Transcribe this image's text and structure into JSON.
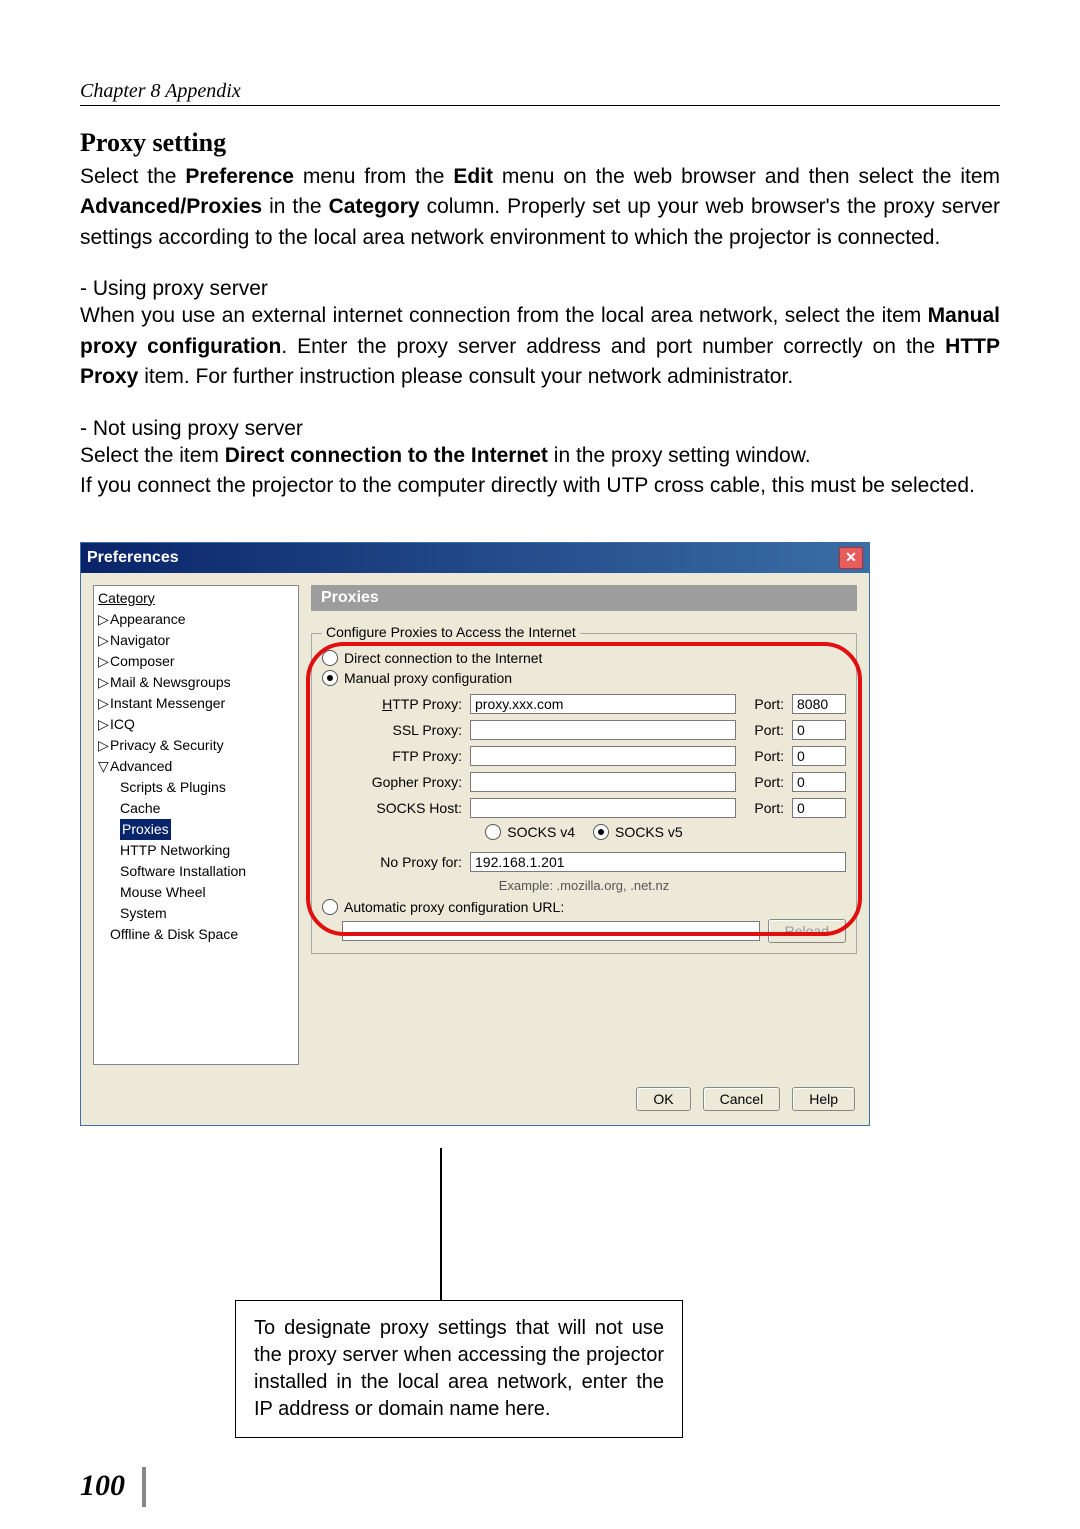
{
  "chapter_header": "Chapter 8 Appendix",
  "section_heading": "Proxy setting",
  "intro_prefix": "Select the ",
  "intro_bold1": "Preference",
  "intro_mid1": " menu from the ",
  "intro_bold2": "Edit",
  "intro_mid2": " menu on the web browser and then select the item ",
  "intro_bold3": "Advanced/Proxies",
  "intro_mid3": " in the ",
  "intro_bold4": "Category",
  "intro_mid4": " column. Properly set up your web browser's the proxy server settings according to the local area network environment to which the projector is connected.",
  "sub1_heading": "- Using proxy server",
  "sub1_prefix": "When you use an external internet connection from the local area network, select the item ",
  "sub1_bold": "Manual proxy configuration",
  "sub1_mid": ". Enter the proxy server address and port number correctly on the ",
  "sub1_bold2": "HTTP Proxy",
  "sub1_suffix": " item. For further instruction please consult your network administrator.",
  "sub2_heading": "- Not using proxy server",
  "sub2_prefix": "Select the item ",
  "sub2_bold": "Direct connection to the Internet",
  "sub2_suffix": " in the proxy setting window.",
  "sub2_line2": "If you connect the projector to the computer directly with UTP cross cable, this must be selected.",
  "dialog": {
    "title": "Preferences",
    "tree_header": "Category",
    "tree": [
      "Appearance",
      "Navigator",
      "Composer",
      "Mail & Newsgroups",
      "Instant Messenger",
      "ICQ",
      "Privacy & Security"
    ],
    "tree_advanced": "Advanced",
    "tree_sub": [
      "Scripts & Plugins",
      "Cache",
      "Proxies",
      "HTTP Networking",
      "Software Installation",
      "Mouse Wheel",
      "System"
    ],
    "tree_last": "Offline & Disk Space",
    "panel_title": "Proxies",
    "legend": "Configure Proxies to Access the Internet",
    "radio1": "Direct connection to the Internet",
    "radio2": "Manual proxy configuration",
    "radio3": "Automatic proxy configuration URL:",
    "rows": {
      "http": {
        "label": "HTTP Proxy:",
        "value": "proxy.xxx.com",
        "port_label": "Port:",
        "port": "8080"
      },
      "ssl": {
        "label": "SSL Proxy:",
        "value": "",
        "port_label": "Port:",
        "port": "0"
      },
      "ftp": {
        "label": "FTP Proxy:",
        "value": "",
        "port_label": "Port:",
        "port": "0"
      },
      "gopher": {
        "label": "Gopher Proxy:",
        "value": "",
        "port_label": "Port:",
        "port": "0"
      },
      "socks": {
        "label": "SOCKS Host:",
        "value": "",
        "port_label": "Port:",
        "port": "0"
      }
    },
    "socksv4": "SOCKS v4",
    "socksv5": "SOCKS v5",
    "no_proxy_label": "No Proxy for:",
    "no_proxy_value": "192.168.1.201",
    "example": "Example: .mozilla.org, .net.nz",
    "reload": "Reload",
    "ok": "OK",
    "cancel": "Cancel",
    "help": "Help"
  },
  "callout": "To designate proxy settings that will not use the proxy server when accessing the projector installed in the local area network, enter the IP address or domain name here.",
  "page_number": "100"
}
